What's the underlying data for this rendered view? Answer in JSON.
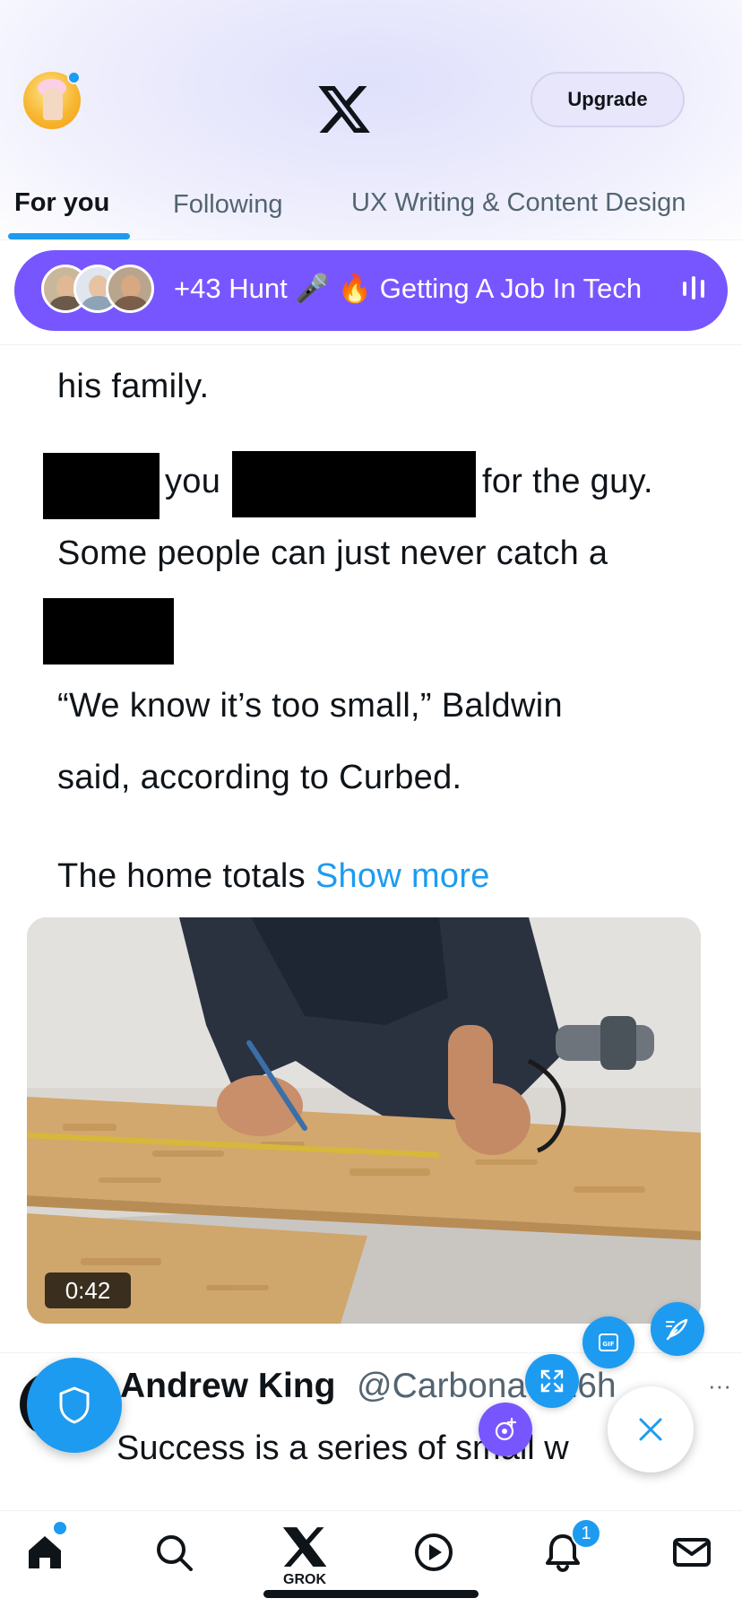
{
  "header": {
    "upgrade_label": "Upgrade"
  },
  "tabs": [
    {
      "label": "For you",
      "active": true
    },
    {
      "label": "Following",
      "active": false
    },
    {
      "label": "UX Writing & Content Design",
      "active": false
    }
  ],
  "spaces": {
    "title": "+43 Hunt 🎤 🔥 Getting A Job In Tech",
    "background": "#7856ff"
  },
  "article": {
    "line1": "his family.",
    "line2_a": "you",
    "line2_b": "for the guy.",
    "line3": "Some people can just never catch a",
    "line4": "“We know it’s too small,” Baldwin",
    "line5": "said, according to Curbed.",
    "line6": "The home totals",
    "show_more": "Show more"
  },
  "media": {
    "duration": "0:42"
  },
  "next_tweet": {
    "name": "Andrew King",
    "handle": "@Carbona",
    "time": "• 16h",
    "text": "Success is a series of small w",
    "more": "···"
  },
  "bottom_nav": {
    "items": [
      {
        "icon": "home-icon"
      },
      {
        "icon": "search-icon"
      },
      {
        "icon": "grok-icon",
        "label": "GROK"
      },
      {
        "icon": "play-icon"
      },
      {
        "icon": "bell-icon"
      },
      {
        "icon": "mail-icon"
      }
    ],
    "grok_label": "GROK",
    "notification_count": "1"
  },
  "colors": {
    "accent": "#1d9bf0",
    "spaces_purple": "#7856ff",
    "text": "#0f1419",
    "secondary_text": "#536471"
  }
}
